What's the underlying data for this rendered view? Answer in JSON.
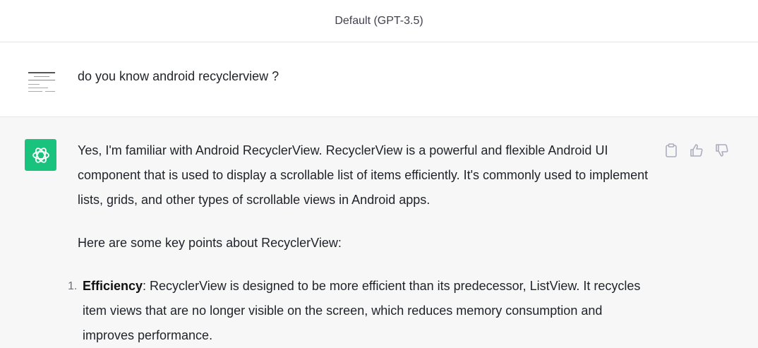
{
  "header": {
    "model_label": "Default (GPT-3.5)"
  },
  "user_message": {
    "text": "do you know android recyclerview ?"
  },
  "assistant_message": {
    "paragraphs": [
      "Yes, I'm familiar with Android RecyclerView. RecyclerView is a powerful and flexible Android UI component that is used to display a scrollable list of items efficiently. It's commonly used to implement lists, grids, and other types of scrollable views in Android apps.",
      "Here are some key points about RecyclerView:"
    ],
    "list": [
      {
        "number": "1.",
        "title": "Efficiency",
        "text": ": RecyclerView is designed to be more efficient than its predecessor, ListView. It recycles item views that are no longer visible on the screen, which reduces memory consumption and improves performance."
      }
    ]
  },
  "colors": {
    "assistant_avatar": "#19c37d",
    "assistant_bg": "#f7f7f8",
    "icon": "#acacbe"
  }
}
